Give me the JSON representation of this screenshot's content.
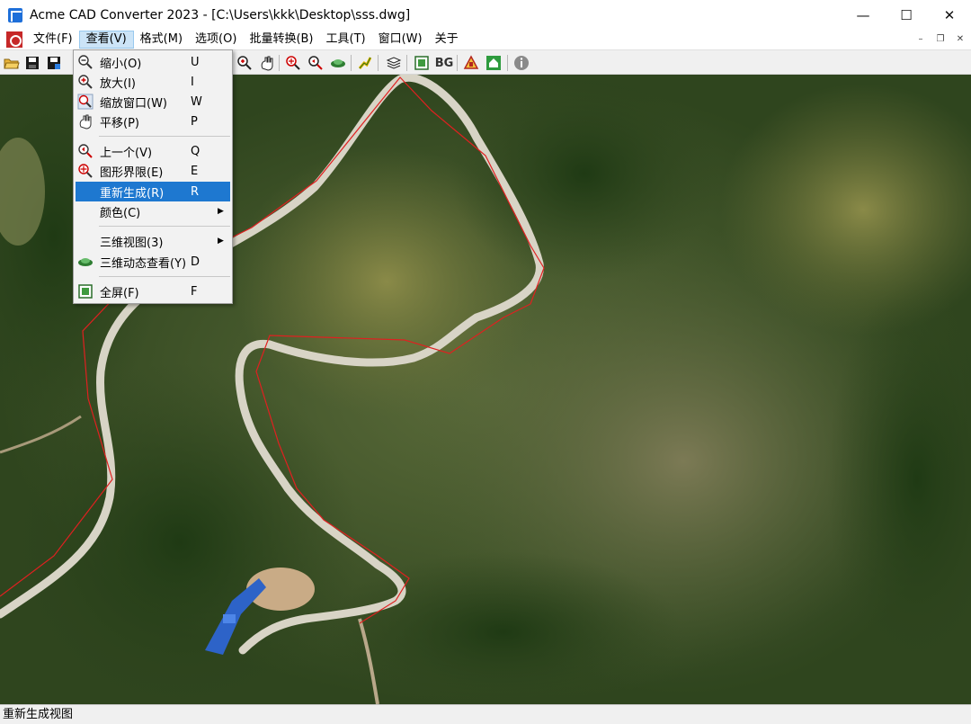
{
  "window": {
    "title": "Acme CAD Converter 2023 - [C:\\Users\\kkk\\Desktop\\sss.dwg]",
    "minimize_glyph": "—",
    "maximize_glyph": "☐",
    "close_glyph": "✕"
  },
  "menubar": {
    "items": [
      {
        "label": "文件(F)"
      },
      {
        "label": "查看(V)"
      },
      {
        "label": "格式(M)"
      },
      {
        "label": "选项(O)"
      },
      {
        "label": "批量转换(B)"
      },
      {
        "label": "工具(T)"
      },
      {
        "label": "窗口(W)"
      },
      {
        "label": "关于"
      }
    ],
    "mdi_min": "–",
    "mdi_restore": "❐",
    "mdi_close": "✕"
  },
  "toolbar": {
    "bg_label": "BG"
  },
  "view_menu": {
    "items": [
      {
        "label": "缩小(O)",
        "key": "U",
        "icon": "zoom-out-icon"
      },
      {
        "label": "放大(I)",
        "key": "I",
        "icon": "zoom-in-icon"
      },
      {
        "label": "缩放窗口(W)",
        "key": "W",
        "icon": "zoom-window-icon"
      },
      {
        "label": "平移(P)",
        "key": "P",
        "icon": "pan-icon"
      },
      {
        "label": "上一个(V)",
        "key": "Q",
        "icon": "zoom-previous-icon"
      },
      {
        "label": "图形界限(E)",
        "key": "E",
        "icon": "zoom-extents-icon"
      },
      {
        "label": "重新生成(R)",
        "key": "R",
        "icon": ""
      },
      {
        "label": "颜色(C)",
        "key": "",
        "icon": ""
      },
      {
        "label": "三维视图(3)",
        "key": "",
        "icon": ""
      },
      {
        "label": "三维动态查看(Y)",
        "key": "D",
        "icon": "3d-orbit-icon"
      },
      {
        "label": "全屏(F)",
        "key": "F",
        "icon": "fullscreen-icon"
      }
    ],
    "highlighted_index": 6,
    "submenu_arrow": "▶"
  },
  "statusbar": {
    "text": "重新生成视图"
  },
  "colors": {
    "highlight": "#1e78d0",
    "boundary_line": "#e02020",
    "road": "#d8d4c6"
  }
}
